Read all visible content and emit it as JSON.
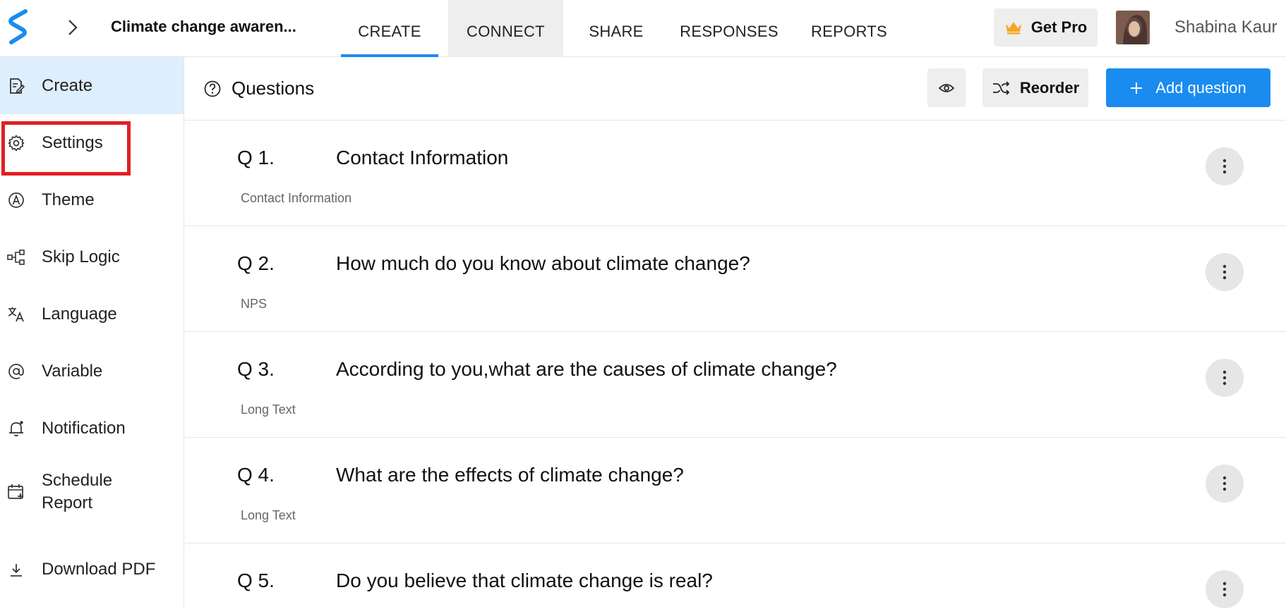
{
  "header": {
    "survey_title": "Climate change awaren...",
    "tabs": [
      {
        "label": "CREATE",
        "active": true
      },
      {
        "label": "CONNECT",
        "hover": true
      },
      {
        "label": "SHARE"
      },
      {
        "label": "RESPONSES"
      },
      {
        "label": "REPORTS"
      }
    ],
    "get_pro_label": "Get Pro",
    "user_name": "Shabina Kaur"
  },
  "sidebar": {
    "items": [
      {
        "label": "Create",
        "icon": "create-form-icon",
        "active": true
      },
      {
        "label": "Settings",
        "icon": "gear-icon",
        "highlighted": true
      },
      {
        "label": "Theme",
        "icon": "theme-icon"
      },
      {
        "label": "Skip Logic",
        "icon": "skip-logic-icon"
      },
      {
        "label": "Language",
        "icon": "language-icon"
      },
      {
        "label": "Variable",
        "icon": "at-sign-icon"
      },
      {
        "label": "Notification",
        "icon": "bell-icon"
      },
      {
        "label": "Schedule Report",
        "label_line1": "Schedule",
        "label_line2": "Report",
        "icon": "calendar-add-icon"
      },
      {
        "label": "Download PDF",
        "icon": "download-icon"
      }
    ]
  },
  "main": {
    "section_title": "Questions",
    "reorder_label": "Reorder",
    "add_question_label": "Add question",
    "questions": [
      {
        "number": "Q 1.",
        "text": "Contact Information",
        "type": "Contact Information"
      },
      {
        "number": "Q 2.",
        "text": "How much do you know about climate change?",
        "type": "NPS"
      },
      {
        "number": "Q 3.",
        "text": "According to you,what are the causes of climate change?",
        "type": "Long Text"
      },
      {
        "number": "Q 4.",
        "text": "What are the effects of climate change?",
        "type": "Long Text"
      },
      {
        "number": "Q 5.",
        "text": "Do you believe that climate change is real?",
        "type": ""
      }
    ]
  },
  "colors": {
    "accent": "#1a8cf0",
    "active_sidebar_bg": "#ddeefd",
    "highlight_border": "#e31e24",
    "crown": "#f5a623"
  }
}
